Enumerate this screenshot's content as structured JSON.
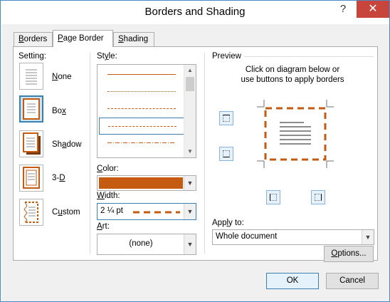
{
  "window": {
    "title": "Borders and Shading",
    "help_glyph": "?",
    "close_glyph": "✕"
  },
  "tabs": [
    {
      "label_pre": "",
      "label_key": "B",
      "label_post": "orders"
    },
    {
      "label_pre": "",
      "label_key": "P",
      "label_post": "age Border"
    },
    {
      "label_pre": "",
      "label_key": "S",
      "label_post": "hading"
    }
  ],
  "setting": {
    "label": "Setting:",
    "options": [
      {
        "label_pre": "",
        "label_key": "N",
        "label_post": "one"
      },
      {
        "label_pre": "Bo",
        "label_key": "x",
        "label_post": ""
      },
      {
        "label_pre": "Sh",
        "label_key": "a",
        "label_post": "dow"
      },
      {
        "label_pre": "3-",
        "label_key": "D",
        "label_post": ""
      },
      {
        "label_pre": "C",
        "label_key": "u",
        "label_post": "stom"
      }
    ],
    "selected_index": 1
  },
  "style": {
    "label_pre": "St",
    "label_key": "y",
    "label_post": "le:",
    "selected_index": 3
  },
  "color": {
    "label_pre": "",
    "label_key": "C",
    "label_post": "olor:",
    "value": "#c55a11"
  },
  "width": {
    "label_pre": "",
    "label_key": "W",
    "label_post": "idth:",
    "value": "2 ¼ pt"
  },
  "art": {
    "label_pre": "",
    "label_key": "A",
    "label_post": "rt:",
    "value": "(none)"
  },
  "preview": {
    "label": "Preview",
    "instruction_line1": "Click on diagram below or",
    "instruction_line2": "use buttons to apply borders",
    "apply_to_label_pre": "App",
    "apply_to_label_key": "l",
    "apply_to_label_post": "y to:",
    "apply_to_value": "Whole document",
    "options_btn_pre": "",
    "options_btn_key": "O",
    "options_btn_post": "ptions..."
  },
  "buttons": {
    "ok": "OK",
    "cancel": "Cancel"
  },
  "colors": {
    "accent": "#c55a11",
    "selection": "#3c7fb1",
    "close": "#c7453b"
  }
}
